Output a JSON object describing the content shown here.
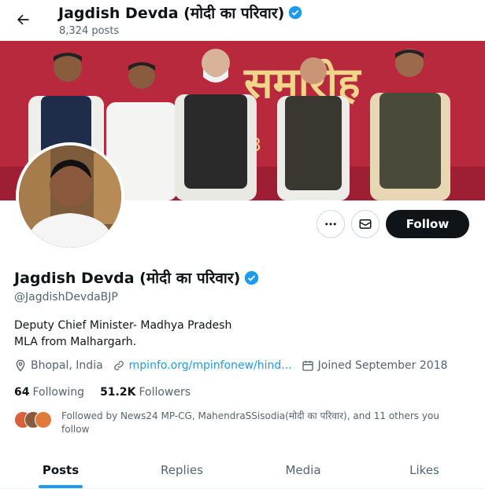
{
  "header": {
    "name": "Jagdish Devda (मोदी का परिवार)",
    "posts_count": "8,324 posts"
  },
  "banner": {
    "banner_text": "समारोह",
    "banner_number": "3"
  },
  "actions": {
    "follow_label": "Follow"
  },
  "profile": {
    "name": "Jagdish Devda (मोदी का परिवार)",
    "handle": "@JagdishDevdaBJP",
    "bio_line1": "Deputy Chief Minister- Madhya Pradesh",
    "bio_line2": "MLA from Malhargarh.",
    "location": "Bhopal, India",
    "website": "mpinfo.org/mpinfonew/hind...",
    "joined": "Joined September 2018",
    "following_count": "64",
    "following_label": "Following",
    "followers_count": "51.2K",
    "followers_label": "Followers",
    "followed_by": "Followed by News24 MP-CG, MahendraSSisodia(मोदी का परिवार), and 11 others you follow"
  },
  "tabs": [
    {
      "label": "Posts",
      "active": true
    },
    {
      "label": "Replies",
      "active": false
    },
    {
      "label": "Media",
      "active": false
    },
    {
      "label": "Likes",
      "active": false
    }
  ],
  "colors": {
    "accent": "#1d9bf0",
    "text": "#0f1419",
    "secondary": "#536471",
    "follow_bg": "#0f1419",
    "banner_bg": "#b8293d"
  }
}
